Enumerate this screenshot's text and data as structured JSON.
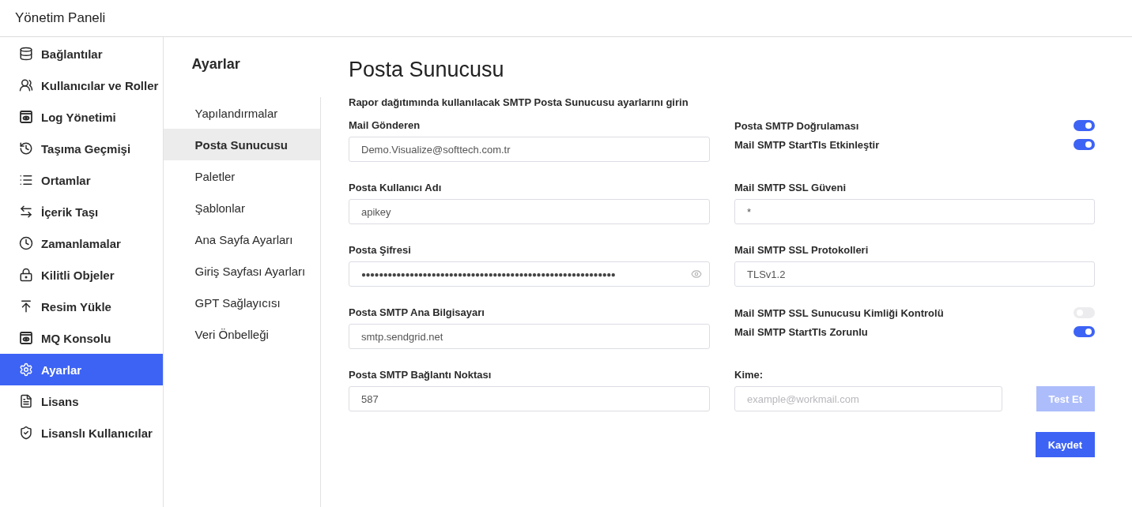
{
  "header": {
    "title": "Yönetim Paneli"
  },
  "sidebar": {
    "items": [
      {
        "label": "Bağlantılar",
        "selected": false
      },
      {
        "label": "Kullanıcılar ve Roller",
        "selected": false
      },
      {
        "label": "Log Yönetimi",
        "selected": false
      },
      {
        "label": "Taşıma Geçmişi",
        "selected": false
      },
      {
        "label": "Ortamlar",
        "selected": false
      },
      {
        "label": "İçerik Taşı",
        "selected": false
      },
      {
        "label": "Zamanlamalar",
        "selected": false
      },
      {
        "label": "Kilitli Objeler",
        "selected": false
      },
      {
        "label": "Resim Yükle",
        "selected": false
      },
      {
        "label": "MQ Konsolu",
        "selected": false
      },
      {
        "label": "Ayarlar",
        "selected": true
      },
      {
        "label": "Lisans",
        "selected": false
      },
      {
        "label": "Lisanslı Kullanıcılar",
        "selected": false
      }
    ]
  },
  "settings_menu": {
    "title": "Ayarlar",
    "items": [
      {
        "label": "Yapılandırmalar",
        "selected": false
      },
      {
        "label": "Posta Sunucusu",
        "selected": true
      },
      {
        "label": "Paletler",
        "selected": false
      },
      {
        "label": "Şablonlar",
        "selected": false
      },
      {
        "label": "Ana Sayfa Ayarları",
        "selected": false
      },
      {
        "label": "Giriş Sayfası Ayarları",
        "selected": false
      },
      {
        "label": "GPT Sağlayıcısı",
        "selected": false
      },
      {
        "label": "Veri Önbelleği",
        "selected": false
      }
    ]
  },
  "page": {
    "title": "Posta Sunucusu",
    "description": "Rapor dağıtımında kullanılacak SMTP Posta Sunucusu ayarlarını girin",
    "left_fields": [
      {
        "label": "Mail Gönderen",
        "value": "Demo.Visualize@softtech.com.tr",
        "kind": "text"
      },
      {
        "label": "Posta Kullanıcı Adı",
        "value": "apikey",
        "kind": "text"
      },
      {
        "label": "Posta Şifresi",
        "value": "●●●●●●●●●●●●●●●●●●●●●●●●●●●●●●●●●●●●●●●●●●●●●●●●●●●●●●●●●●",
        "kind": "password"
      },
      {
        "label": "Posta SMTP Ana Bilgisayarı",
        "value": "smtp.sendgrid.net",
        "kind": "text"
      },
      {
        "label": "Posta SMTP Bağlantı Noktası",
        "value": "587",
        "kind": "text"
      }
    ],
    "right_groups": [
      {
        "kind": "toggles",
        "items": [
          {
            "label": "Posta SMTP Doğrulaması",
            "on": true
          },
          {
            "label": "Mail SMTP StartTls Etkinleştir",
            "on": true
          }
        ]
      },
      {
        "kind": "field",
        "label": "Mail SMTP SSL Güveni",
        "value": "*"
      },
      {
        "kind": "field",
        "label": "Mail SMTP SSL Protokolleri",
        "value": "TLSv1.2"
      },
      {
        "kind": "toggles",
        "items": [
          {
            "label": "Mail SMTP SSL Sunucusu Kimliği Kontrolü",
            "on": false
          },
          {
            "label": "Mail SMTP StartTls Zorunlu",
            "on": true
          }
        ]
      },
      {
        "kind": "test",
        "label": "Kime:",
        "placeholder": "example@workmail.com",
        "button": {
          "label": "Test Et",
          "disabled": true
        }
      }
    ],
    "save_button": "Kaydet"
  }
}
